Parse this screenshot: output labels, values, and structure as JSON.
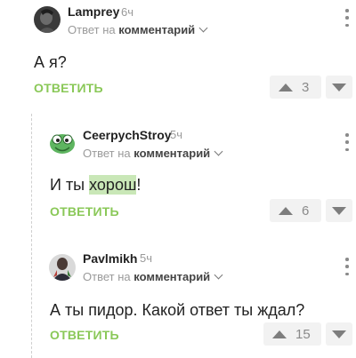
{
  "reply_to_prefix": "Ответ на",
  "reply_to_target": "комментарий",
  "comments": [
    {
      "author": "Lamprey",
      "time": "6ч",
      "text": "А я?",
      "reply_label": "ОТВЕТИТЬ",
      "votes": "3"
    },
    {
      "author": "CeerpychStroy",
      "time": "5ч",
      "text_before": "И ты ",
      "text_highlight": "хорош",
      "text_after": "!",
      "reply_label": "ОТВЕТИТЬ",
      "votes": "6"
    },
    {
      "author": "Pavlmikh",
      "time": "5ч",
      "text": "А ты пидор. Какой ответ ты ждал?",
      "reply_label": "ОТВЕТИТЬ",
      "votes": "15"
    }
  ],
  "colors": {
    "reply_green": "#8ac858",
    "highlight": "#c9e7b7",
    "muted": "#9a9a9a"
  },
  "icons": [
    "kebab-menu-icon",
    "chevron-down-icon",
    "upvote-arrow-icon",
    "downvote-arrow-icon"
  ]
}
